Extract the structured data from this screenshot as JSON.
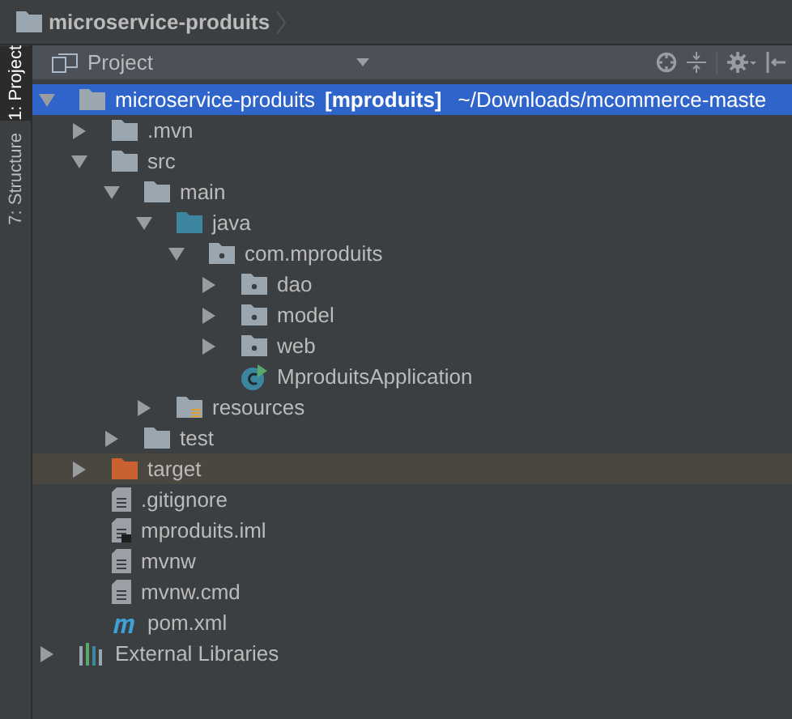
{
  "breadcrumb": {
    "title": "microservice-produits"
  },
  "tool_strip": [
    {
      "label": "1: Project",
      "selected": true
    },
    {
      "label": "7: Structure",
      "selected": false
    }
  ],
  "panel": {
    "title": "Project"
  },
  "tree": [
    {
      "kind": "module",
      "label": "microservice-produits",
      "module": "[mproduits]",
      "path": "~/Downloads/mcommerce-maste",
      "expanded": true,
      "selected": true,
      "children": [
        {
          "kind": "folder",
          "label": ".mvn",
          "expanded": false,
          "selected": false
        },
        {
          "kind": "folder",
          "label": "src",
          "expanded": true,
          "selected": false,
          "children": [
            {
              "kind": "folder",
              "label": "main",
              "expanded": true,
              "selected": false,
              "children": [
                {
                  "kind": "source-folder",
                  "label": "java",
                  "expanded": true,
                  "selected": false,
                  "children": [
                    {
                      "kind": "package",
                      "label": "com.mproduits",
                      "expanded": true,
                      "selected": false,
                      "children": [
                        {
                          "kind": "package",
                          "label": "dao",
                          "expanded": false,
                          "selected": false
                        },
                        {
                          "kind": "package",
                          "label": "model",
                          "expanded": false,
                          "selected": false
                        },
                        {
                          "kind": "package",
                          "label": "web",
                          "expanded": false,
                          "selected": false
                        },
                        {
                          "kind": "class",
                          "label": "MproduitsApplication",
                          "selected": false
                        }
                      ]
                    }
                  ]
                },
                {
                  "kind": "resources-folder",
                  "label": "resources",
                  "expanded": false,
                  "selected": false
                }
              ]
            },
            {
              "kind": "folder",
              "label": "test",
              "expanded": false,
              "selected": false
            }
          ]
        },
        {
          "kind": "excluded-folder",
          "label": "target",
          "expanded": false,
          "selected": false
        },
        {
          "kind": "file",
          "label": ".gitignore",
          "selected": false
        },
        {
          "kind": "module-file",
          "label": "mproduits.iml",
          "selected": false
        },
        {
          "kind": "file",
          "label": "mvnw",
          "selected": false
        },
        {
          "kind": "file",
          "label": "mvnw.cmd",
          "selected": false
        },
        {
          "kind": "maven",
          "label": "pom.xml",
          "selected": false
        }
      ]
    },
    {
      "kind": "libraries",
      "label": "External Libraries",
      "expanded": false,
      "selected": false
    }
  ]
}
